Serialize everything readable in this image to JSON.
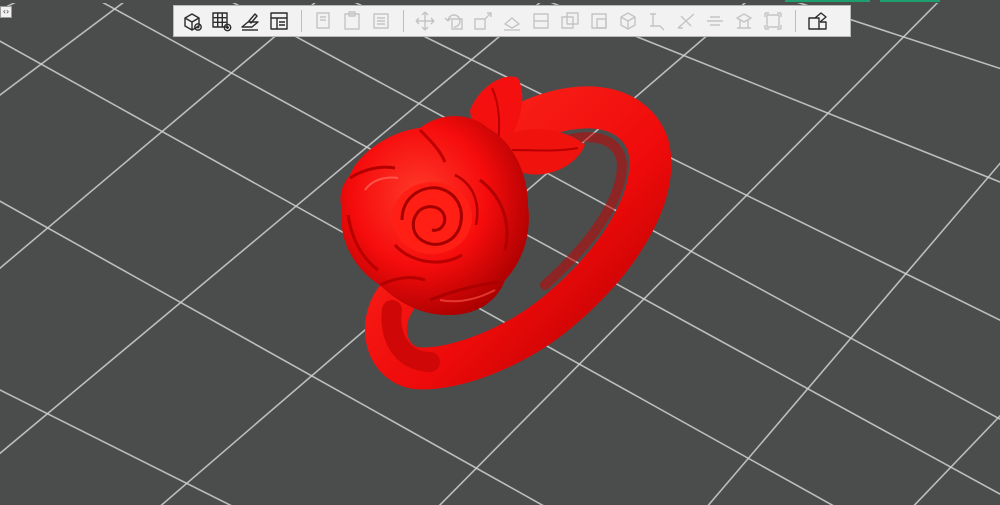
{
  "app": {
    "panel_toggle_glyph": "‹›"
  },
  "colors": {
    "viewport_bg": "#4b4c4c",
    "grid_line": "#cfd2d2",
    "model": "#ff1010",
    "accent": "#1f9e6f"
  },
  "toolbar": {
    "groups": [
      [
        {
          "icon": "add-box-icon",
          "enabled": true
        },
        {
          "icon": "add-grid-icon",
          "enabled": true
        },
        {
          "icon": "edit-plane-icon",
          "enabled": true
        },
        {
          "icon": "layout-panel-icon",
          "enabled": true
        }
      ],
      [
        {
          "icon": "copy-icon",
          "enabled": false
        },
        {
          "icon": "paste-icon",
          "enabled": false
        },
        {
          "icon": "list-icon",
          "enabled": false
        }
      ],
      [
        {
          "icon": "move-icon",
          "enabled": false
        },
        {
          "icon": "rotate-icon",
          "enabled": false
        },
        {
          "icon": "scale-icon",
          "enabled": false
        },
        {
          "icon": "lay-flat-icon",
          "enabled": false
        },
        {
          "icon": "center-icon",
          "enabled": false
        },
        {
          "icon": "duplicate-icon",
          "enabled": false
        },
        {
          "icon": "fill-icon",
          "enabled": false
        },
        {
          "icon": "cube-icon",
          "enabled": false
        },
        {
          "icon": "measure-icon",
          "enabled": false
        },
        {
          "icon": "cut-icon",
          "enabled": false
        },
        {
          "icon": "flatten-icon",
          "enabled": false
        },
        {
          "icon": "support-icon",
          "enabled": false
        },
        {
          "icon": "bounds-icon",
          "enabled": false
        }
      ],
      [
        {
          "icon": "arrange-icon",
          "enabled": true
        }
      ]
    ]
  }
}
